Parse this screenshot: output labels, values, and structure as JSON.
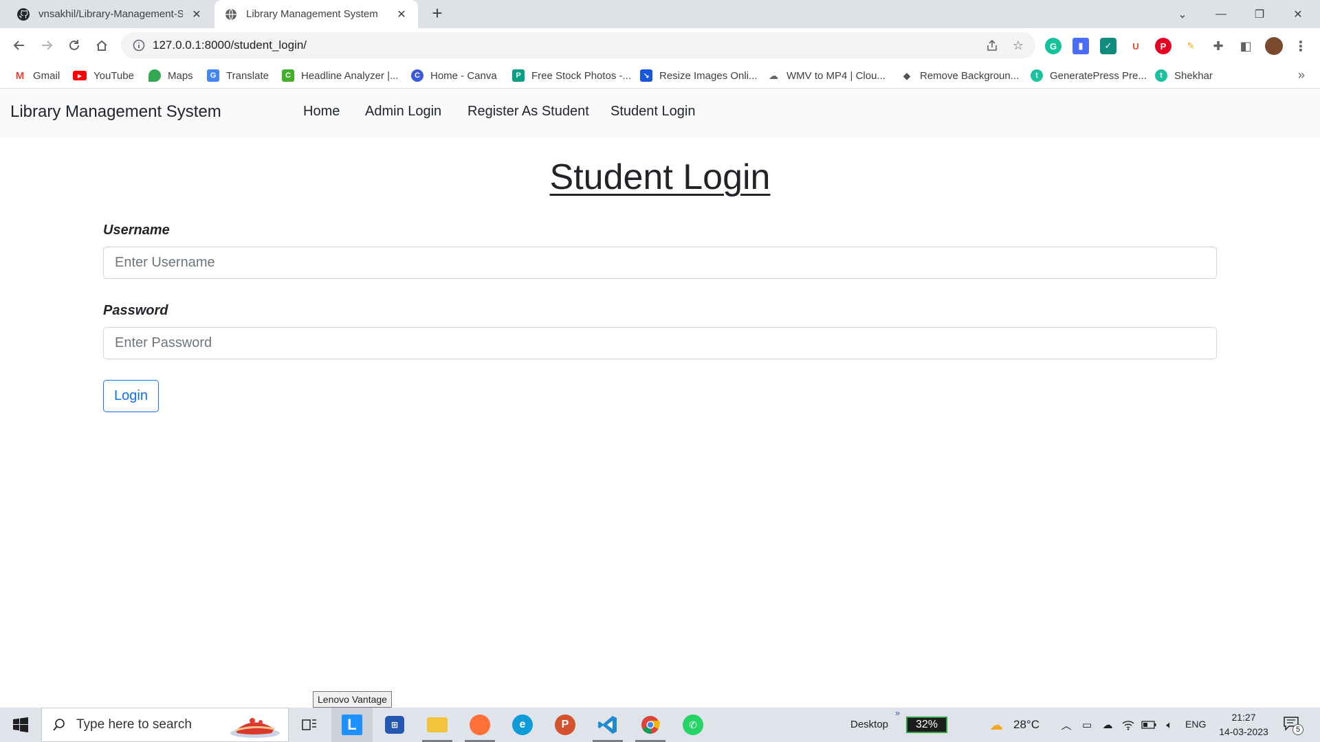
{
  "browser": {
    "tabs": [
      {
        "title": "vnsakhil/Library-Management-Sy",
        "icon": "github-icon",
        "active": false
      },
      {
        "title": "Library Management System",
        "icon": "globe-icon",
        "active": true
      }
    ],
    "url": "127.0.0.1:8000/student_login/",
    "bookmarks": [
      {
        "label": "Gmail",
        "icon": "gmail-icon"
      },
      {
        "label": "YouTube",
        "icon": "youtube-icon"
      },
      {
        "label": "Maps",
        "icon": "maps-icon"
      },
      {
        "label": "Translate",
        "icon": "translate-icon"
      },
      {
        "label": "Headline Analyzer |...",
        "icon": "headline-analyzer-icon"
      },
      {
        "label": "Home - Canva",
        "icon": "canva-icon"
      },
      {
        "label": "Free Stock Photos -...",
        "icon": "stock-photos-icon"
      },
      {
        "label": "Resize Images Onli...",
        "icon": "resize-images-icon"
      },
      {
        "label": "WMV to MP4 | Clou...",
        "icon": "cloudconvert-icon"
      },
      {
        "label": "Remove Backgroun...",
        "icon": "remove-bg-icon"
      },
      {
        "label": "GeneratePress Pre...",
        "icon": "generatepress-icon"
      },
      {
        "label": "Shekhar",
        "icon": "shekhar-icon"
      }
    ]
  },
  "navbar": {
    "brand": "Library Management System",
    "links": [
      "Home",
      "Admin Login",
      "Register As Student",
      "Student Login"
    ]
  },
  "page": {
    "title": "Student Login",
    "username_label": "Username",
    "username_placeholder": "Enter Username",
    "password_label": "Password",
    "password_placeholder": "Enter Password",
    "login_button": "Login"
  },
  "tooltip": "Lenovo Vantage",
  "taskbar": {
    "search_placeholder": "Type here to search",
    "desktop_label": "Desktop",
    "battery": "32%",
    "weather": "28°C",
    "language": "ENG",
    "time": "21:27",
    "date": "14-03-2023",
    "notification_count": "5"
  },
  "colors": {
    "primary": "#0d6efd",
    "navbar_bg": "#f8f9fa",
    "tabstrip_bg": "#dee1e6",
    "taskbar_bg": "#dfe3ea"
  }
}
